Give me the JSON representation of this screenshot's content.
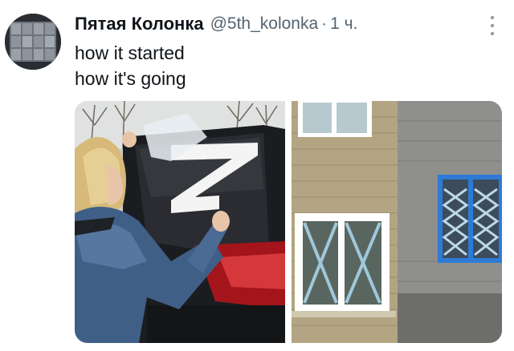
{
  "tweet": {
    "display_name": "Пятая Колонка",
    "handle": "@5th_kolonka",
    "separator": "·",
    "time": "1 ч.",
    "lines": [
      "how it started",
      "how it's going"
    ]
  },
  "icons": {
    "more": "more-vertical-icon"
  },
  "colors": {
    "text": "#0f1419",
    "secondary": "#536471",
    "window_blue": "#2e7bd6"
  }
}
